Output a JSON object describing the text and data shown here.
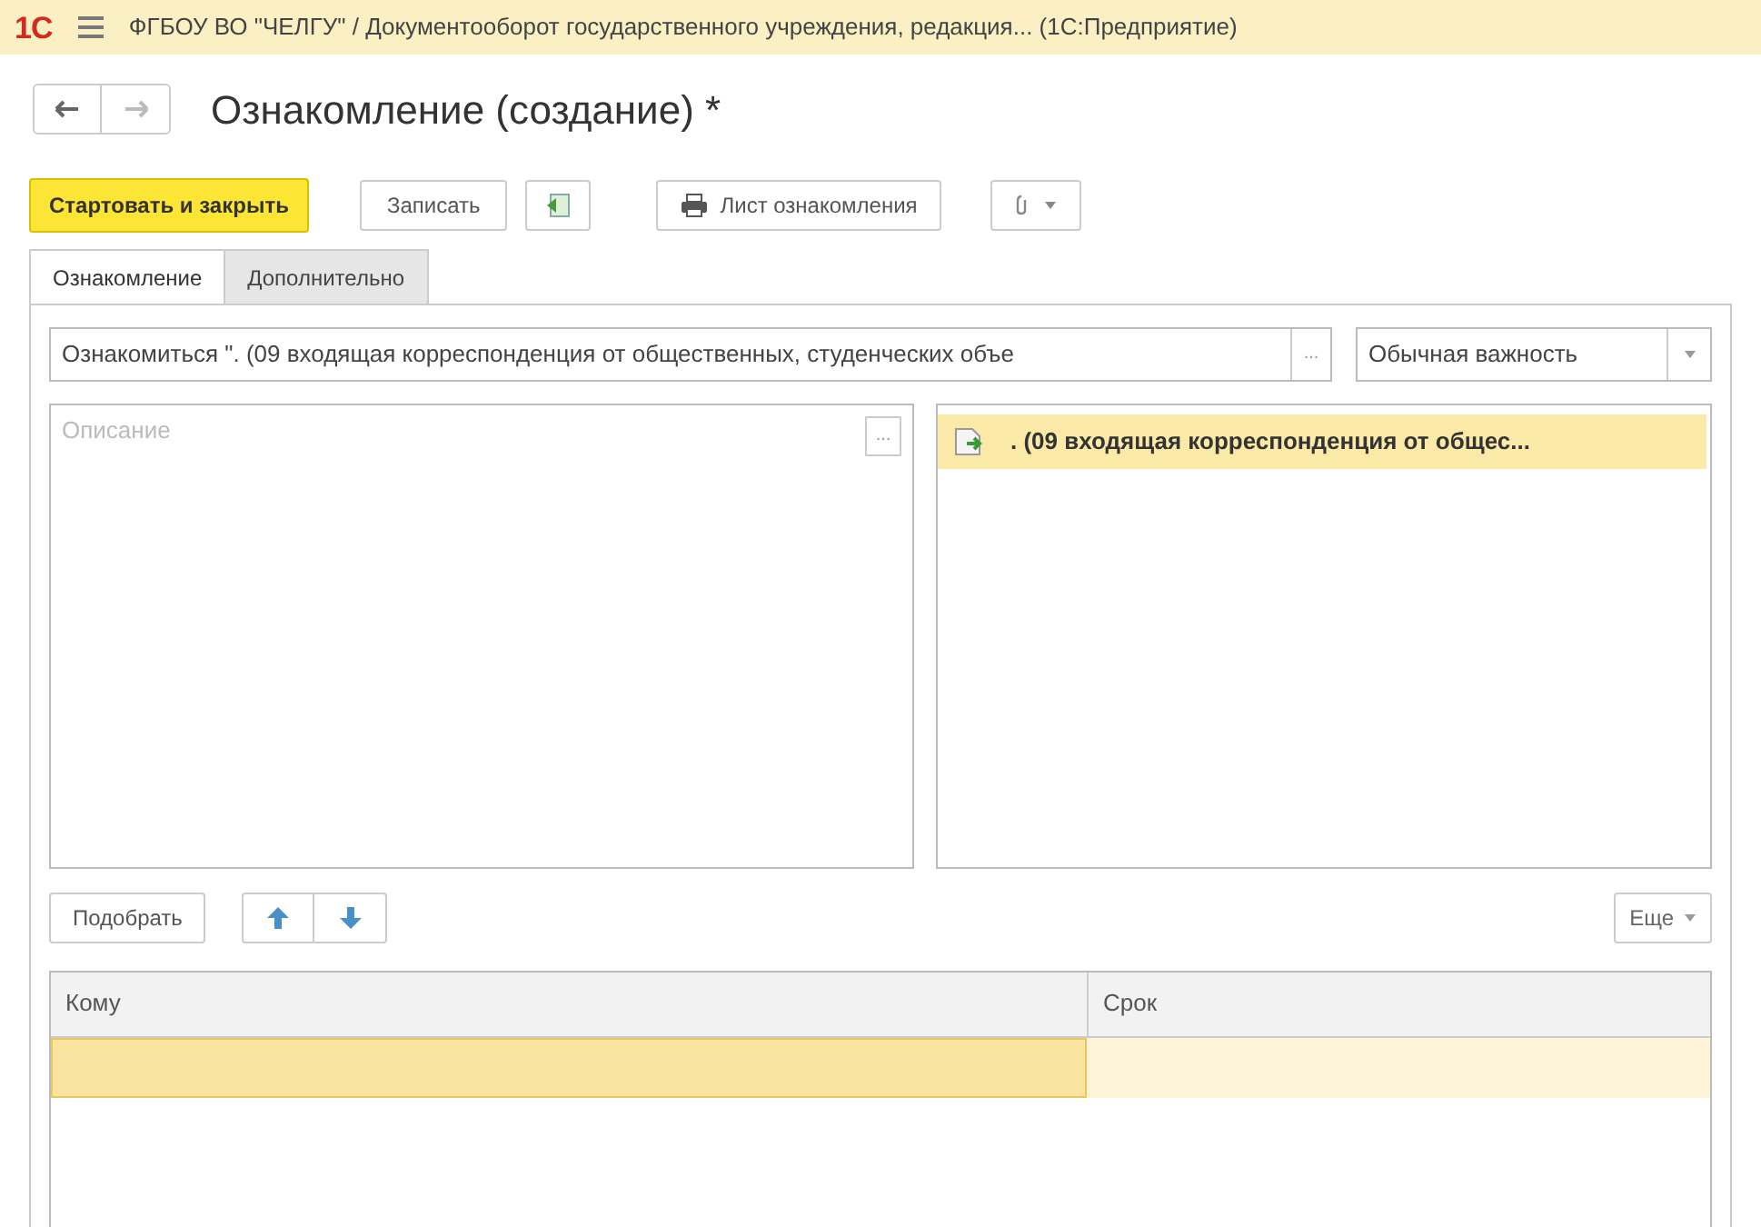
{
  "window": {
    "logo": "1С",
    "title": "ФГБОУ ВО \"ЧЕЛГУ\" / Документооборот государственного учреждения, редакция...  (1С:Предприятие)"
  },
  "form": {
    "title": "Ознакомление (создание) *"
  },
  "toolbar": [
    {
      "kind": "primary",
      "label": "Стартовать и закрыть"
    },
    {
      "kind": "plain",
      "label": "Записать"
    },
    {
      "kind": "icon"
    },
    {
      "kind": "print",
      "label": "Лист ознакомления"
    },
    {
      "kind": "clip"
    }
  ],
  "tabs": [
    {
      "label": "Ознакомление",
      "selected": true
    },
    {
      "label": "Дополнительно",
      "selected": false
    }
  ],
  "subject": {
    "value": "Ознакомиться \". (09 входящая корреспонденция от общественных, студенческих объе",
    "button": "..."
  },
  "importance": {
    "value": "Обычная важность"
  },
  "description": {
    "placeholder": "Описание",
    "button": "..."
  },
  "attachments": [
    {
      "label": ". (09 входящая корреспонденция от общес...",
      "selected": true
    }
  ],
  "table_toolbar": {
    "pick": "Подобрать",
    "more": "Еще"
  },
  "table": {
    "columns": [
      "Кому",
      "Срок"
    ],
    "rows": [
      {
        "selected": true
      }
    ]
  }
}
